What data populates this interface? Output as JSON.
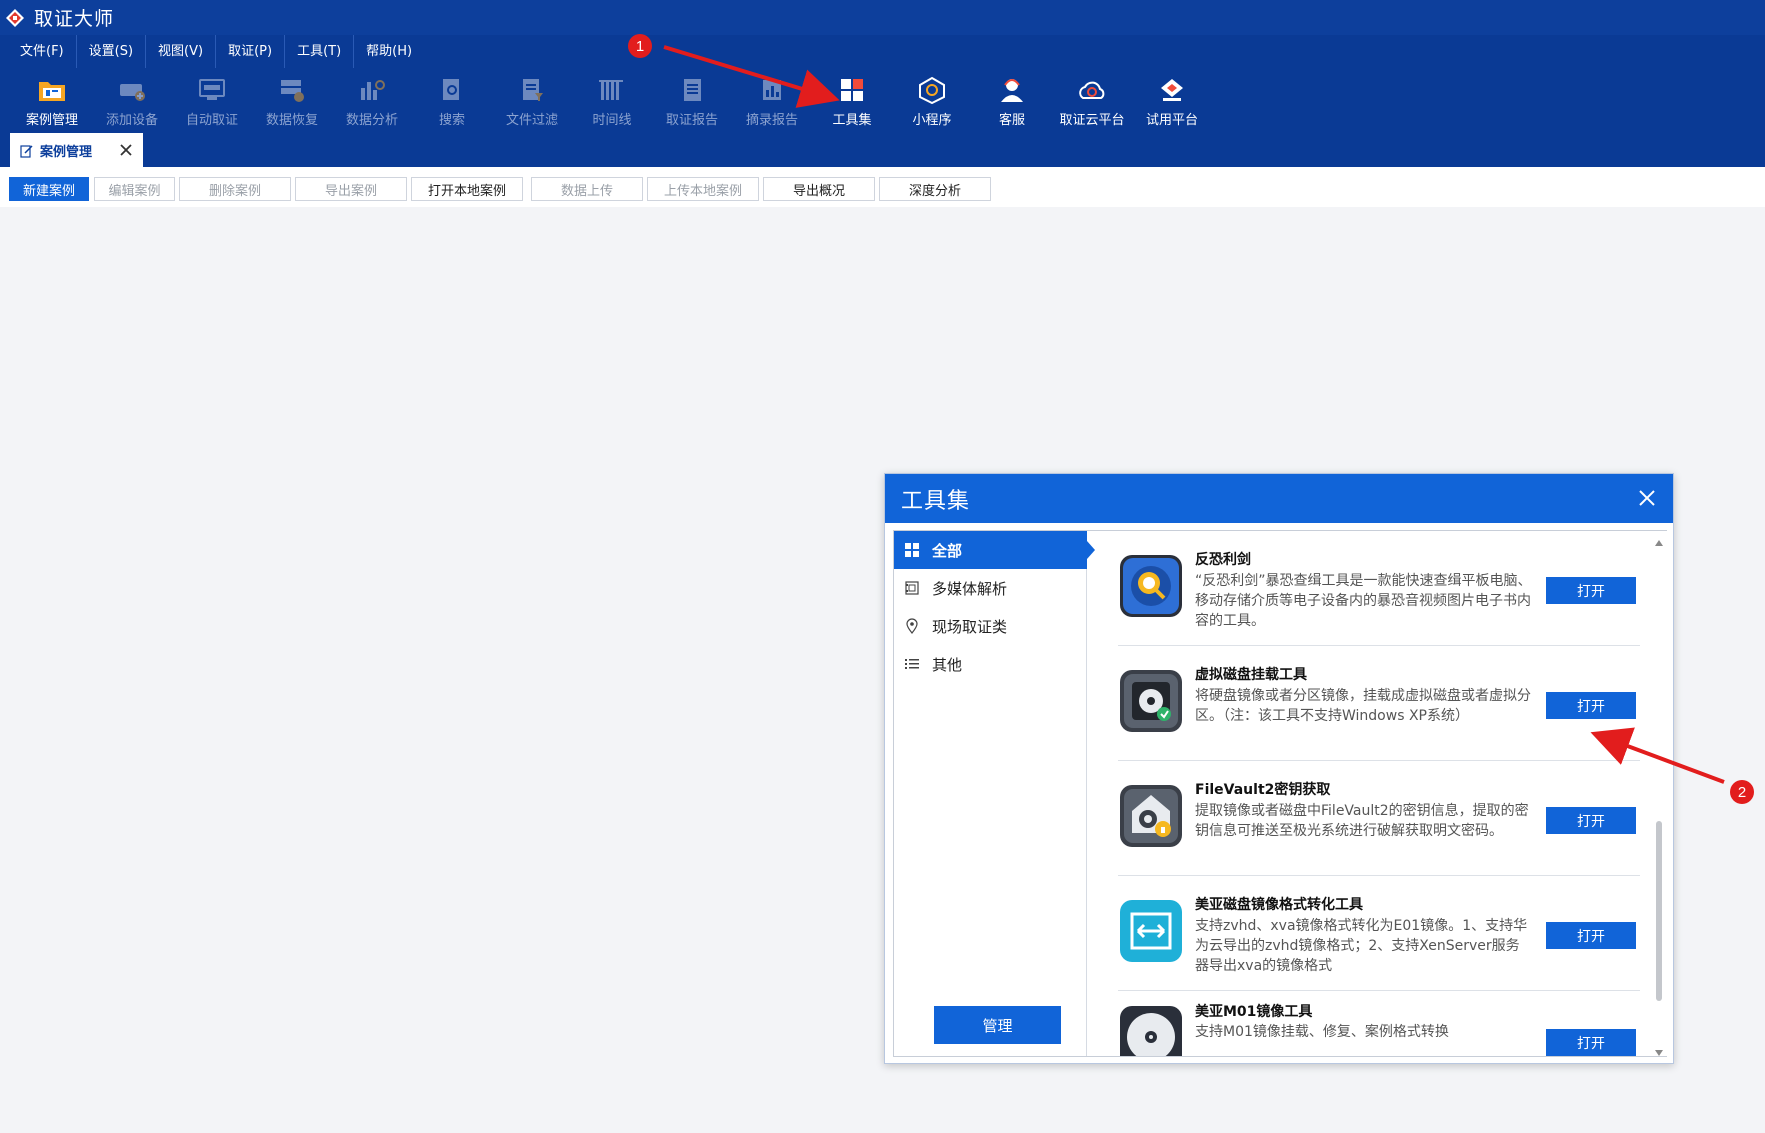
{
  "app": {
    "title": "取证大师"
  },
  "menu": {
    "items": [
      "文件(F)",
      "设置(S)",
      "视图(V)",
      "取证(P)",
      "工具(T)",
      "帮助(H)"
    ]
  },
  "toolbar": {
    "items": [
      {
        "label": "案例管理",
        "icon": "case-folder-icon",
        "enabled": true
      },
      {
        "label": "添加设备",
        "icon": "add-device-icon",
        "enabled": false
      },
      {
        "label": "自动取证",
        "icon": "auto-forensics-icon",
        "enabled": false
      },
      {
        "label": "数据恢复",
        "icon": "data-recovery-icon",
        "enabled": false
      },
      {
        "label": "数据分析",
        "icon": "data-analysis-icon",
        "enabled": false
      },
      {
        "label": "搜索",
        "icon": "search-icon",
        "enabled": false
      },
      {
        "label": "文件过滤",
        "icon": "file-filter-icon",
        "enabled": false
      },
      {
        "label": "时间线",
        "icon": "timeline-icon",
        "enabled": false
      },
      {
        "label": "取证报告",
        "icon": "forensic-report-icon",
        "enabled": false
      },
      {
        "label": "摘录报告",
        "icon": "excerpt-report-icon",
        "enabled": false
      },
      {
        "label": "工具集",
        "icon": "toolset-grid-icon",
        "enabled": true
      },
      {
        "label": "小程序",
        "icon": "mini-program-icon",
        "enabled": true
      },
      {
        "label": "客服",
        "icon": "customer-service-icon",
        "enabled": true
      },
      {
        "label": "取证云平台",
        "icon": "cloud-platform-icon",
        "enabled": true
      },
      {
        "label": "试用平台",
        "icon": "trial-platform-icon",
        "enabled": true
      }
    ]
  },
  "tab": {
    "label": "案例管理"
  },
  "actions": [
    {
      "label": "新建案例",
      "state": "primary"
    },
    {
      "label": "编辑案例",
      "state": "disabled"
    },
    {
      "label": "删除案例",
      "state": "disabled"
    },
    {
      "label": "导出案例",
      "state": "disabled"
    },
    {
      "label": "打开本地案例",
      "state": "normal"
    },
    {
      "label": "数据上传",
      "state": "disabled"
    },
    {
      "label": "上传本地案例",
      "state": "disabled"
    },
    {
      "label": "导出概况",
      "state": "normal"
    },
    {
      "label": "深度分析",
      "state": "normal"
    }
  ],
  "annotations": [
    "1",
    "2"
  ],
  "dialog": {
    "title": "工具集",
    "sidebar": {
      "items": [
        {
          "label": "全部",
          "icon": "grid-icon"
        },
        {
          "label": "多媒体解析",
          "icon": "film-icon"
        },
        {
          "label": "现场取证类",
          "icon": "location-pin-icon"
        },
        {
          "label": "其他",
          "icon": "list-icon"
        }
      ],
      "manage_label": "管理"
    },
    "tools": [
      {
        "name": "反恐利剑",
        "desc": "“反恐利剑”暴恐查缉工具是一款能快速查缉平板电脑、移动存储介质等电子设备内的暴恐音视频图片电子书内容的工具。",
        "open": "打开",
        "icon": "anti-terror-sword-icon"
      },
      {
        "name": "虚拟磁盘挂载工具",
        "desc": "将硬盘镜像或者分区镜像，挂载成虚拟磁盘或者虚拟分区。（注：该工具不支持Windows XP系统）",
        "open": "打开",
        "icon": "virtual-disk-mount-icon"
      },
      {
        "name": "FileVault2密钥获取",
        "desc": "提取镜像或者磁盘中FileVault2的密钥信息，提取的密钥信息可推送至极光系统进行破解获取明文密码。",
        "open": "打开",
        "icon": "filevault-key-icon"
      },
      {
        "name": "美亚磁盘镜像格式转化工具",
        "desc": "支持zvhd、xva镜像格式转化为E01镜像。1、支持华为云导出的zvhd镜像格式；2、支持XenServer服务器导出xva的镜像格式",
        "open": "打开",
        "icon": "image-format-convert-icon"
      },
      {
        "name": "美亚M01镜像工具",
        "desc": "支持M01镜像挂载、修复、案例格式转换",
        "open": "打开",
        "icon": "m01-image-disc-icon"
      }
    ]
  },
  "colors": {
    "titlebar": "#0d3f9c",
    "toolbar": "#0a3a95",
    "accent": "#1164d8",
    "annotation": "#e21d1d"
  }
}
